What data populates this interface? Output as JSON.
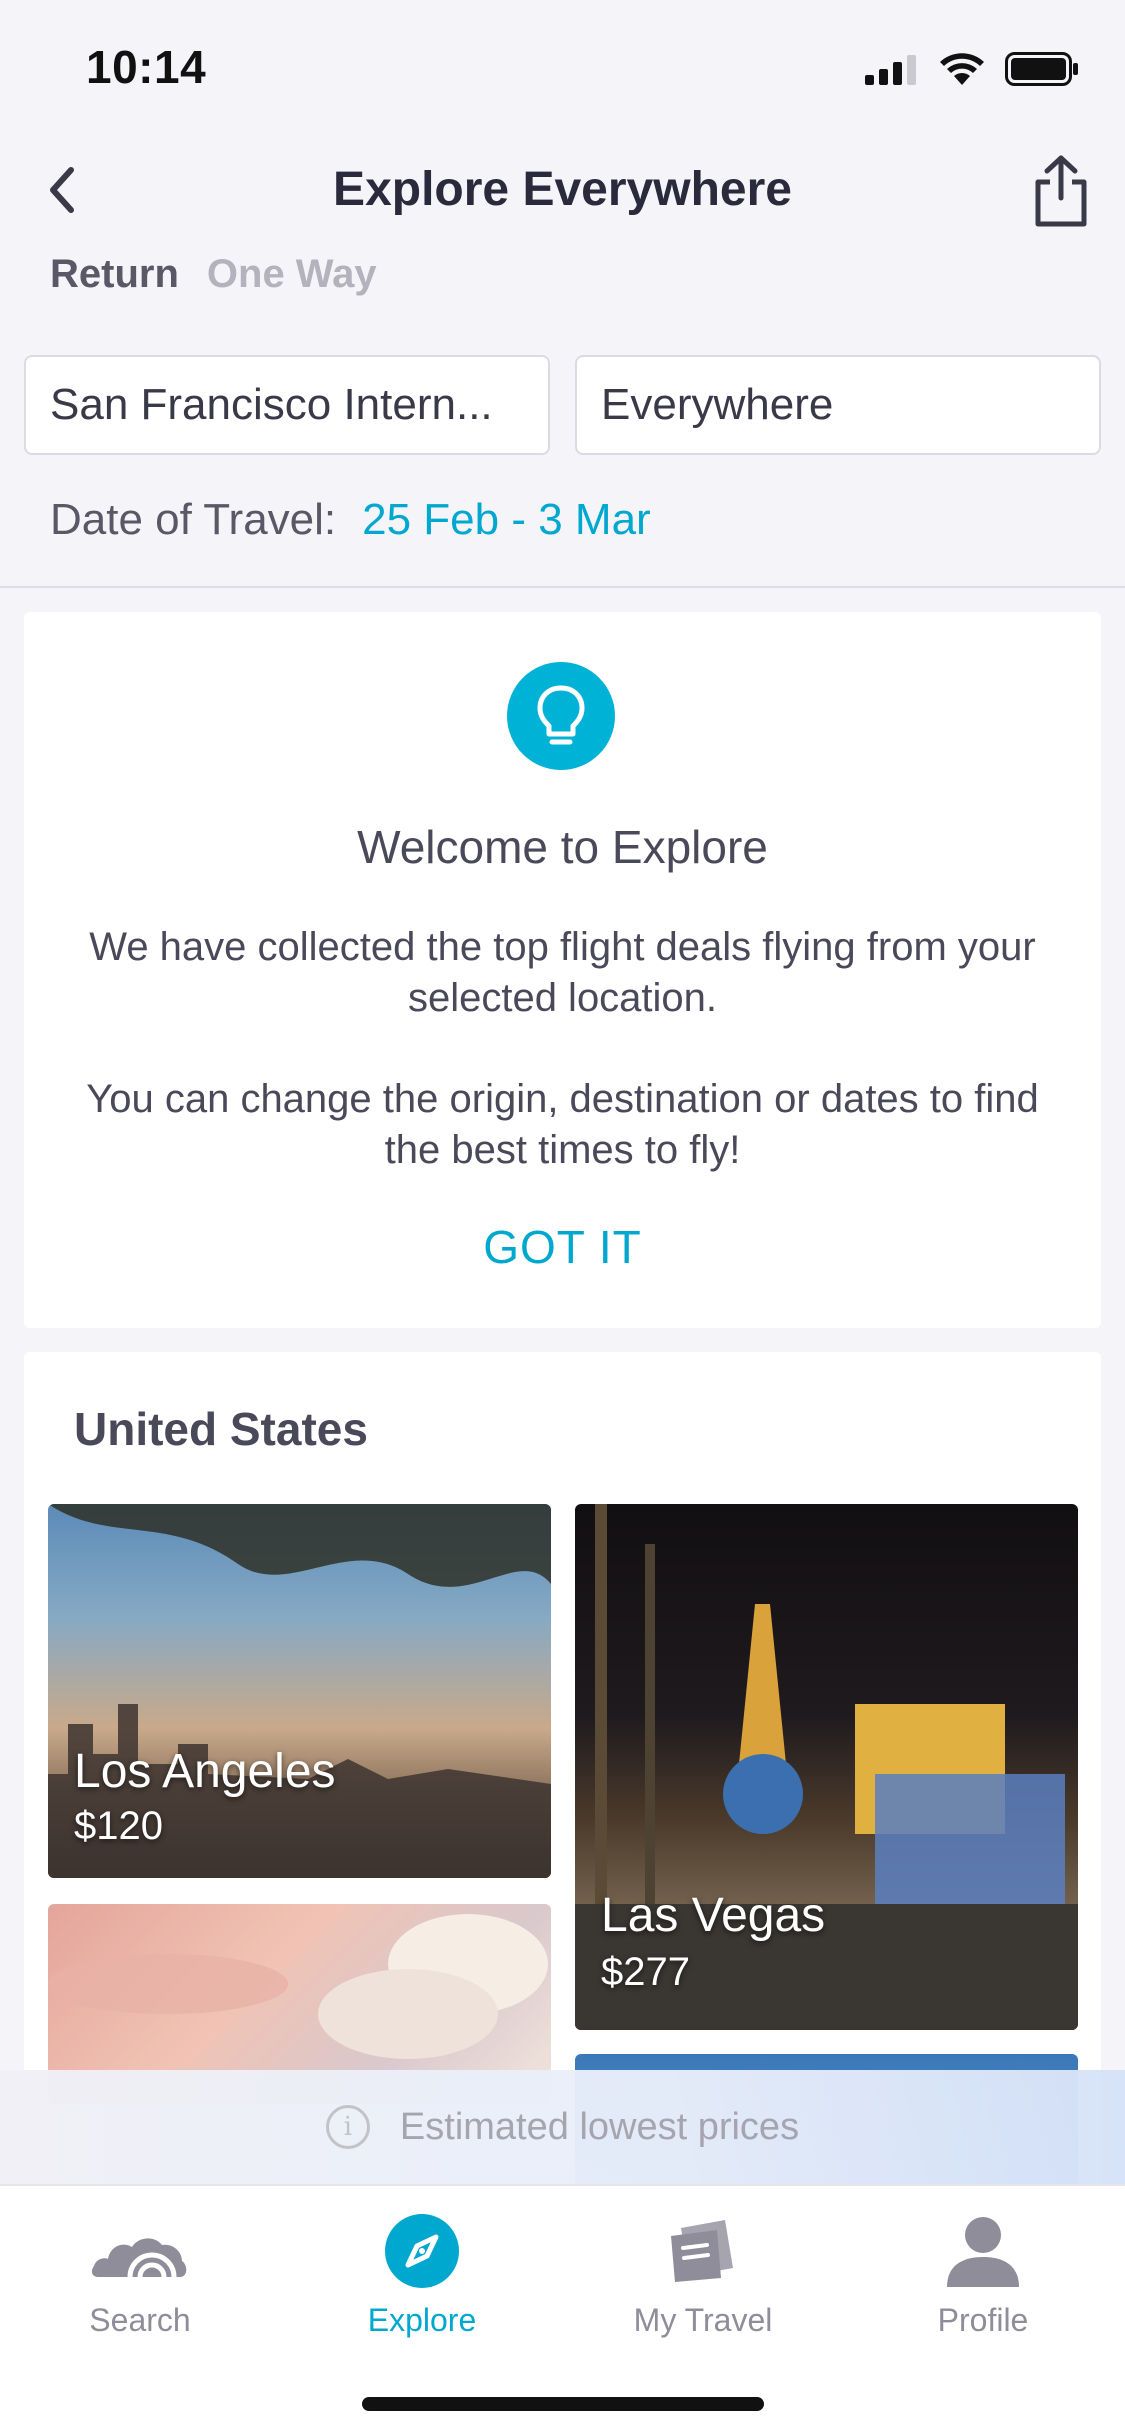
{
  "status_bar": {
    "time": "10:14"
  },
  "nav": {
    "title": "Explore Everywhere"
  },
  "trip_type": {
    "return_label": "Return",
    "one_way_label": "One Way"
  },
  "fields": {
    "origin": "San Francisco Intern...",
    "destination": "Everywhere"
  },
  "dates": {
    "label": "Date of Travel:",
    "value": "25 Feb - 3 Mar"
  },
  "welcome": {
    "title": "Welcome to Explore",
    "paragraph1": "We have collected the top flight deals flying from your selected location.",
    "paragraph2": "You can change the origin, destination or dates to find the best times to fly!",
    "button": "GOT IT"
  },
  "destinations": {
    "heading": "United States",
    "items": [
      {
        "name": "Los Angeles",
        "price": "$120"
      },
      {
        "name": "Las Vegas",
        "price": "$277"
      }
    ]
  },
  "banner": {
    "text": "Estimated lowest prices"
  },
  "tabs": [
    {
      "label": "Search",
      "icon": "search-cloud-icon"
    },
    {
      "label": "Explore",
      "icon": "compass-icon"
    },
    {
      "label": "My Travel",
      "icon": "travel-docs-icon"
    },
    {
      "label": "Profile",
      "icon": "person-icon"
    }
  ],
  "colors": {
    "accent": "#00a8d0",
    "background": "#f5f5f9",
    "inactive": "#8e8d99"
  }
}
